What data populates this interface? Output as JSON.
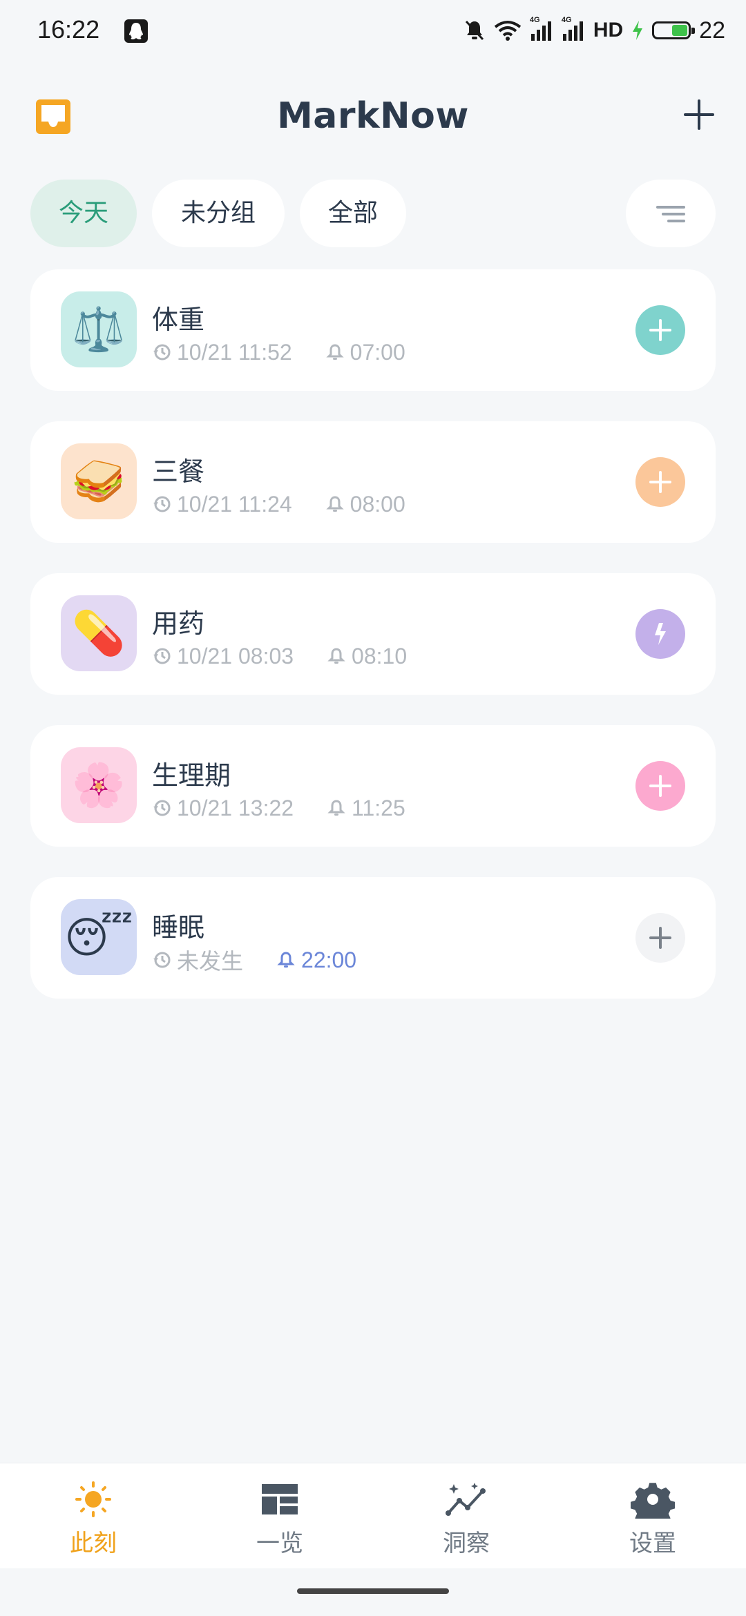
{
  "status_bar": {
    "time": "16:22",
    "network_1": "4G",
    "network_2": "4G",
    "hd": "HD",
    "battery": "22"
  },
  "header": {
    "title": "MarkNow",
    "left_icon": "inbox-icon",
    "right_icon": "plus-icon"
  },
  "filters": {
    "tabs": [
      "今天",
      "未分组",
      "全部"
    ],
    "active": "今天",
    "sort_icon": "sort-lines-icon"
  },
  "items": [
    {
      "emoji": "⚖️",
      "title": "体重",
      "last": "10/21 11:52",
      "reminder": "07:00",
      "bg": "#c8ede9",
      "action_color": "#7fd3cd",
      "action_icon": "plus-icon"
    },
    {
      "emoji": "🥪",
      "title": "三餐",
      "last": "10/21 11:24",
      "reminder": "08:00",
      "bg": "#fde3cd",
      "action_color": "#fbc79a",
      "action_icon": "plus-icon"
    },
    {
      "emoji": "💊",
      "title": "用药",
      "last": "10/21 08:03",
      "reminder": "08:10",
      "bg": "#e3d9f3",
      "action_color": "#c3b0ea",
      "action_icon": "lightning-icon"
    },
    {
      "emoji": "🌸",
      "title": "生理期",
      "last": "10/21 13:22",
      "reminder": "11:25",
      "bg": "#fdd5e6",
      "action_color": "#fca9cf",
      "action_icon": "plus-icon"
    },
    {
      "emoji": "😴",
      "title": "睡眠",
      "last": "未发生",
      "reminder": "22:00",
      "bg": "#d2daf5",
      "action_color": "#f2f3f5",
      "action_icon": "plus-icon"
    }
  ],
  "bottom_nav": [
    {
      "label": "此刻",
      "icon": "sun-icon",
      "active": true
    },
    {
      "label": "一览",
      "icon": "dashboard-icon",
      "active": false
    },
    {
      "label": "洞察",
      "icon": "insight-chart-icon",
      "active": false
    },
    {
      "label": "设置",
      "icon": "gear-icon",
      "active": false
    }
  ],
  "colors": {
    "accent_green": "#2a9d7a",
    "nav_active": "#f0a21b",
    "reminder_accent": "#6b86d8"
  }
}
